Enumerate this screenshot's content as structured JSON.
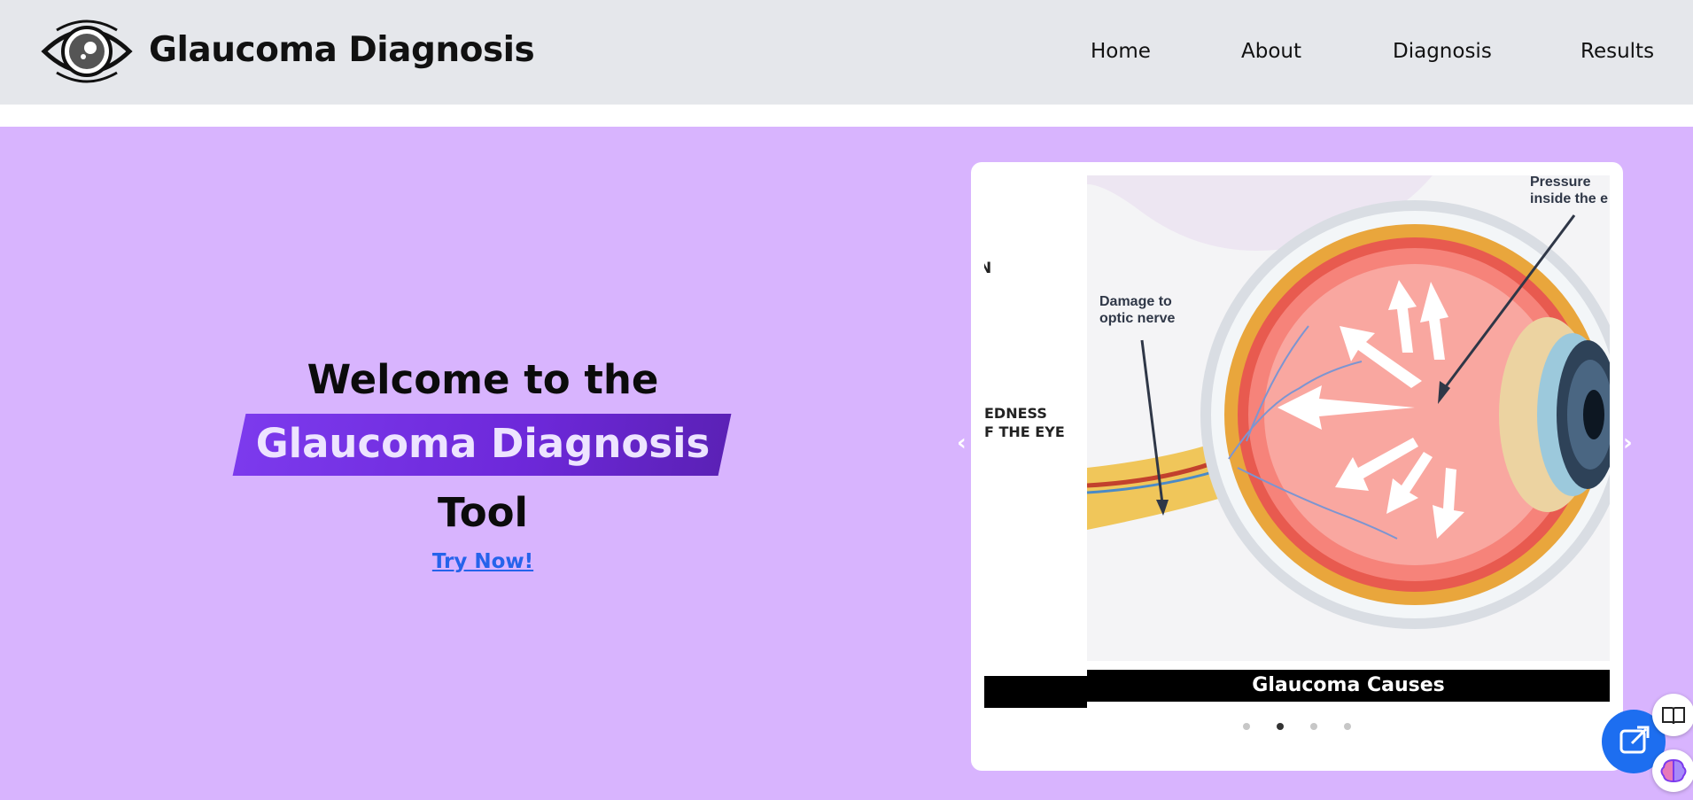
{
  "navbar": {
    "brand": "Glaucoma Diagnosis",
    "links": [
      "Home",
      "About",
      "Diagnosis",
      "Results"
    ]
  },
  "hero": {
    "line1": "Welcome to the",
    "highlight": "Glaucoma Diagnosis",
    "line3": "Tool",
    "cta": "Try Now!"
  },
  "carousel": {
    "prev_slide_text_a": "N",
    "prev_slide_text_b1": "EDNESS",
    "prev_slide_text_b2": "F THE EYE",
    "slide_labels": {
      "damage_1": "Damage to",
      "damage_2": "optic nerve",
      "pressure_1": "Pressure",
      "pressure_2": "inside the e"
    },
    "caption": "Glaucoma Causes",
    "slide_count": 4,
    "active_index": 1,
    "prev_arrow": "‹",
    "next_arrow": "›"
  },
  "colors": {
    "hero_bg": "#d8b4fe",
    "banner": "#7c3aed",
    "link": "#2563eb",
    "fab": "#1d6ef0"
  },
  "icons": [
    "eye-logo-icon",
    "external-link-icon",
    "book-icon",
    "brain-icon"
  ]
}
